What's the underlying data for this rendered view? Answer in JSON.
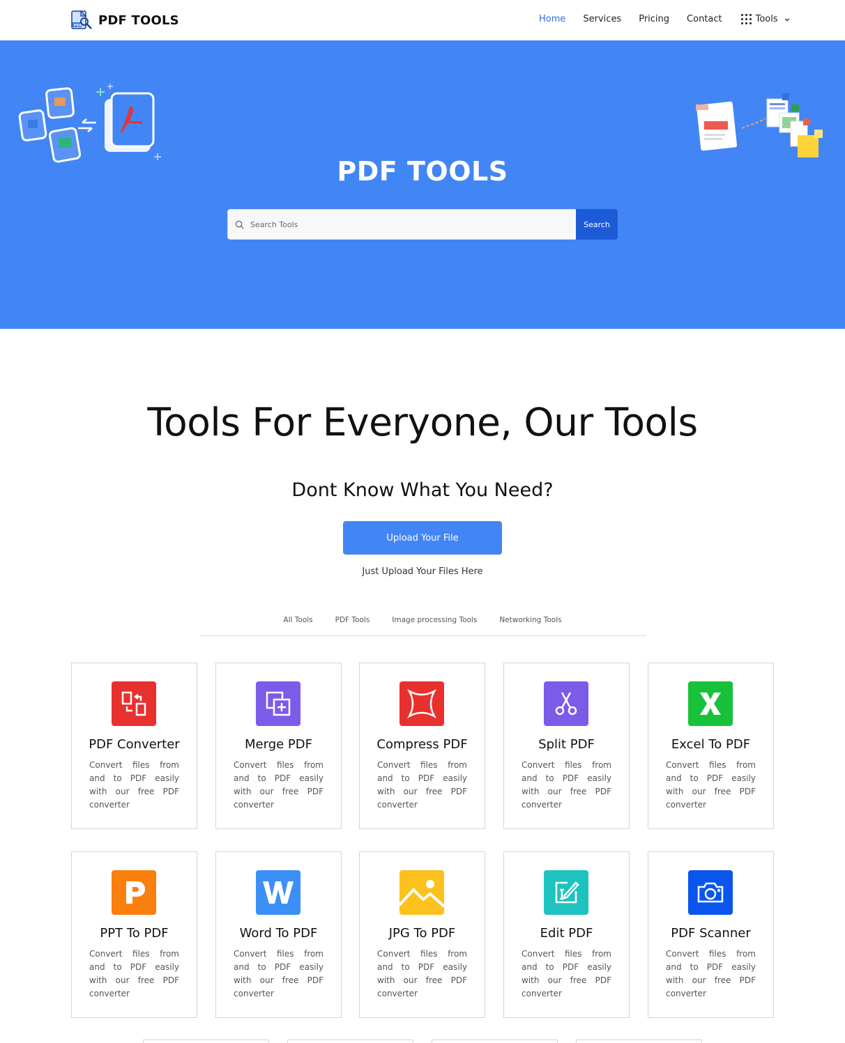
{
  "nav": {
    "brand": "PDF TOOLS",
    "links": [
      "Home",
      "Services",
      "Pricing",
      "Contact"
    ],
    "tools_label": "Tools",
    "active": "Home"
  },
  "hero": {
    "title": "PDF TOOLS",
    "search_placeholder": "Search Tools",
    "search_button": "Search"
  },
  "main": {
    "title": "Tools For Everyone, Our Tools",
    "subtitle": "Dont Know What You Need?",
    "upload_button": "Upload Your File",
    "upload_hint": "Just Upload Your Files Here",
    "tabs": [
      "All Tools",
      "PDF Tools",
      "Image processing Tools",
      "Networking Tools"
    ]
  },
  "tools": [
    {
      "title": "PDF Converter",
      "desc": "Convert files from and to PDF easily with our free PDF converter",
      "icon": "convert-icon",
      "color": "#e8312f"
    },
    {
      "title": "Merge PDF",
      "desc": "Convert files from and to PDF easily with our free PDF converter",
      "icon": "merge-icon",
      "color": "#7b5ce8"
    },
    {
      "title": "Compress PDF",
      "desc": "Convert files from and to PDF easily with our free PDF converter",
      "icon": "compress-icon",
      "color": "#e8312f"
    },
    {
      "title": "Split PDF",
      "desc": "Convert files from and to PDF easily with our free PDF converter",
      "icon": "scissors-icon",
      "color": "#7b5ce8"
    },
    {
      "title": "Excel To PDF",
      "desc": "Convert files from and to PDF easily with our free PDF converter",
      "icon": "excel-icon",
      "color": "#17c23a"
    },
    {
      "title": "PPT To PDF",
      "desc": "Convert files from and to PDF easily with our free PDF converter",
      "icon": "ppt-icon",
      "color": "#fb7f0c"
    },
    {
      "title": "Word To PDF",
      "desc": "Convert files from and to PDF easily with our free PDF converter",
      "icon": "word-icon",
      "color": "#3b8ff6"
    },
    {
      "title": "JPG To PDF",
      "desc": "Convert files from and to PDF easily with our free PDF converter",
      "icon": "image-icon",
      "color": "#fcc11c"
    },
    {
      "title": "Edit PDF",
      "desc": "Convert files from and to PDF easily with our free PDF converter",
      "icon": "edit-icon",
      "color": "#1ec3c0"
    },
    {
      "title": "PDF Scanner",
      "desc": "Convert files from and to PDF easily with our free PDF converter",
      "icon": "camera-icon",
      "color": "#0a55ee"
    }
  ],
  "colors": {
    "hero_bg": "#4285f4",
    "accent": "#2f6fdf",
    "search_button": "#1d5bd6"
  }
}
